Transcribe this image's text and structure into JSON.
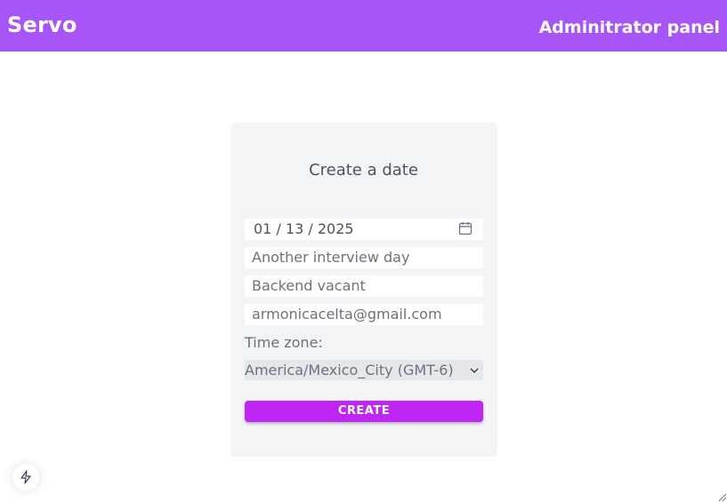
{
  "header": {
    "brand": "Servo",
    "panel_title": "Adminitrator panel"
  },
  "form": {
    "title": "Create a date",
    "date_value": "01 / 13 / 2025",
    "title_value": "Another interview day",
    "subject_value": "Backend vacant",
    "email_value": "armonicacelta@gmail.com",
    "timezone_label": "Time zone:",
    "timezone_value": "America/Mexico_City (GMT-6)",
    "submit_label": "CREATE"
  },
  "icons": {
    "calendar": "calendar-icon",
    "chevron": "chevron-down-icon",
    "bolt": "lightning-bolt-icon",
    "resize": "resize-grip-icon"
  },
  "colors": {
    "header_bg": "#a855f7",
    "button_bg": "#c026f3",
    "card_bg": "#f3f4f6"
  }
}
